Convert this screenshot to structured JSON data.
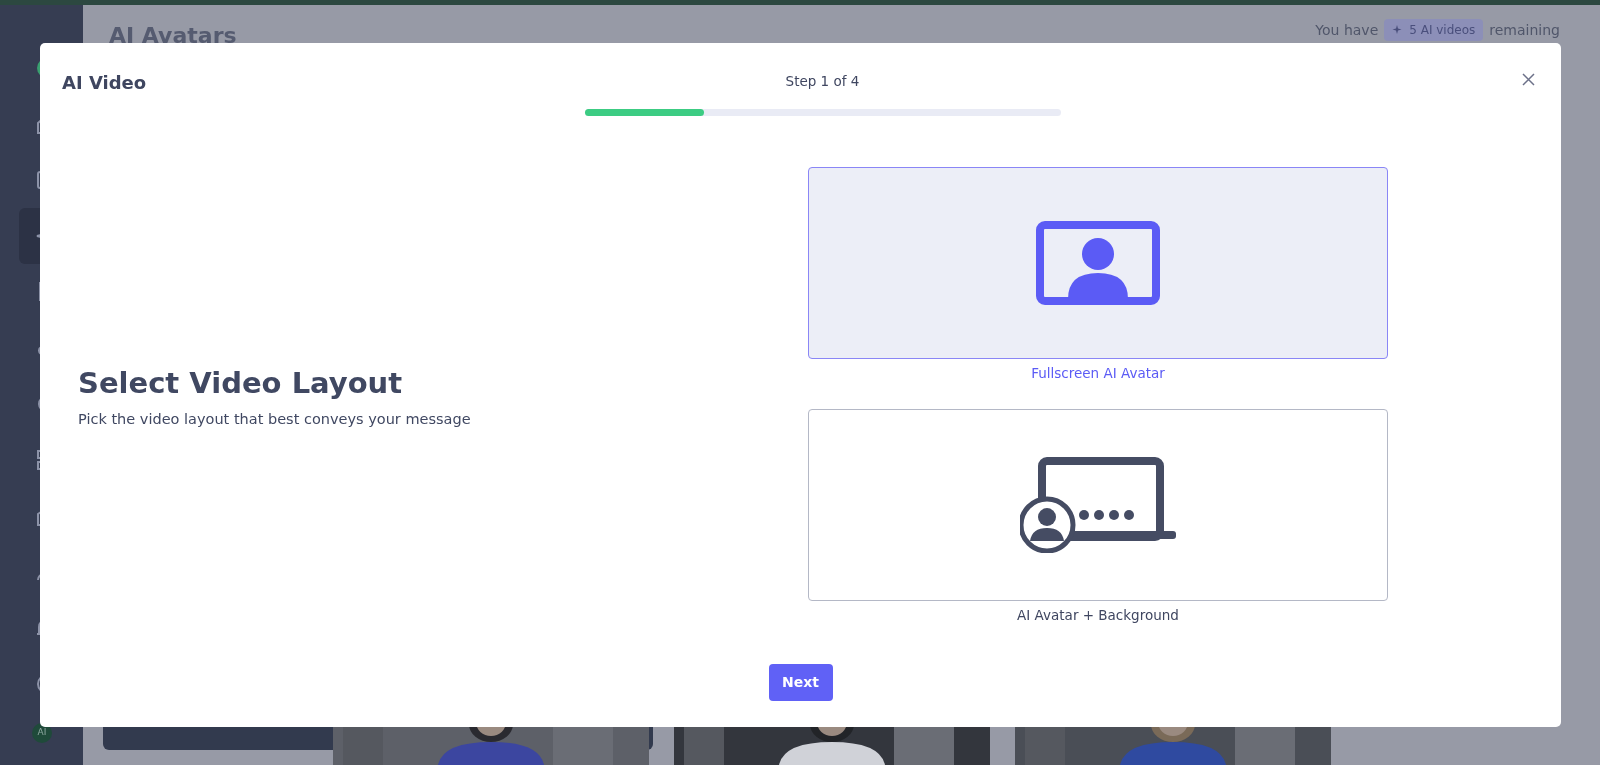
{
  "background": {
    "page_title": "AI Avatars",
    "quota": {
      "prefix": "You have",
      "badge": "5 AI videos",
      "suffix": "remaining"
    },
    "avatar": "AI"
  },
  "modal": {
    "title": "AI Video",
    "step": "Step 1 of 4",
    "progress": {
      "level": 0.25
    },
    "heading": "Select Video Layout",
    "subtitle": "Pick the video layout that best conveys your message",
    "layouts": [
      {
        "kind": "fullscreen",
        "label": "Fullscreen AI Avatar",
        "selected": true
      },
      {
        "kind": "background",
        "label": "AI Avatar + Background",
        "selected": false
      }
    ],
    "next_button": "Next"
  }
}
